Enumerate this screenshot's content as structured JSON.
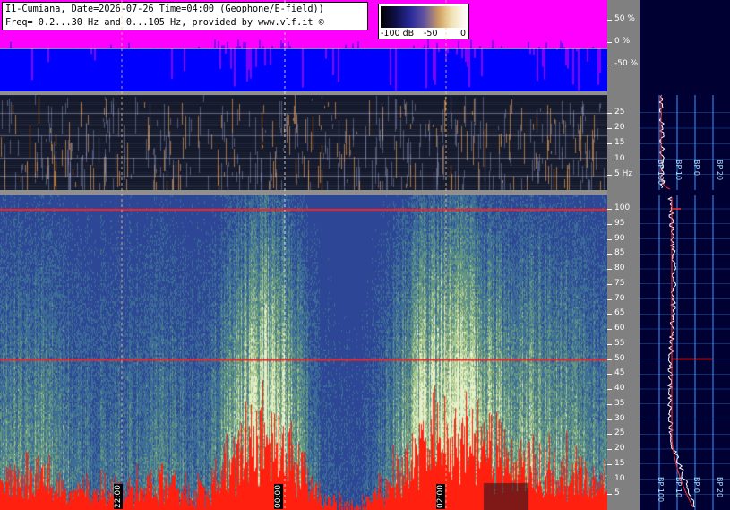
{
  "info": {
    "line1": "I1-Cumiana, Date=2026-07-26 Time=04:00 (Geophone/E-field))",
    "line2": "Freq= 0.2...30 Hz and 0...105 Hz, provided by www.vlf.it ©"
  },
  "colorbar": {
    "labels": [
      "-100 dB",
      "-50",
      "0"
    ]
  },
  "colors": {
    "top_fill": "#ff00ff",
    "top_blue": "#0000ff",
    "mains_line": "#ff2020",
    "profile_bg": "#000033",
    "grid": "#3399ff"
  },
  "chart_data": [
    {
      "type": "area",
      "panel": "signal-percent",
      "yticks": [
        "50 %",
        "0 %",
        "-50 %"
      ],
      "ylim": [
        -100,
        100
      ]
    },
    {
      "type": "heatmap",
      "panel": "low-frequency-spectrogram",
      "yticks": [
        "25",
        "20",
        "15",
        "10",
        "5 Hz"
      ],
      "ylim": [
        0,
        30
      ]
    },
    {
      "type": "heatmap",
      "panel": "main-spectrogram",
      "yticks": [
        "100",
        "95",
        "90",
        "85",
        "80",
        "75",
        "70",
        "65",
        "60",
        "55",
        "50",
        "45",
        "40",
        "35",
        "30",
        "25",
        "20",
        "15",
        "10",
        "5"
      ],
      "ylim": [
        0,
        105
      ],
      "time_labels": [
        "22:00",
        "00:00",
        "02:00"
      ],
      "mains_lines_hz": [
        100,
        50
      ]
    },
    {
      "type": "line",
      "panel": "profile-low",
      "bp_labels": [
        "BP 100",
        "BP 10",
        "BP 0",
        "BP 20"
      ]
    },
    {
      "type": "line",
      "panel": "profile-main",
      "bp_labels": [
        "BP 100",
        "BP 10",
        "BP 0",
        "BP 20"
      ]
    }
  ]
}
